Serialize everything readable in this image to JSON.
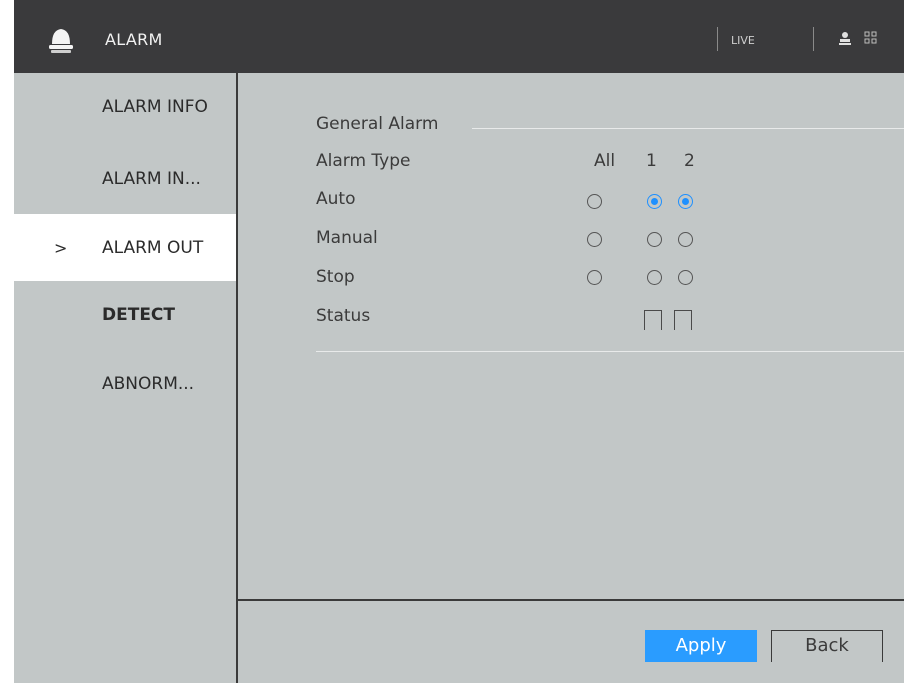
{
  "header": {
    "title": "ALARM",
    "live_label": "LIVE",
    "icons": [
      "alarm-bell-icon",
      "user-icon",
      "grid-icon"
    ]
  },
  "sidebar": {
    "items": [
      {
        "label": "ALARM INFO",
        "active": false,
        "bold": false
      },
      {
        "label": "ALARM IN...",
        "active": false,
        "bold": false
      },
      {
        "label": "ALARM OUT",
        "active": true,
        "bold": false,
        "chevron": ">"
      },
      {
        "label": "DETECT",
        "active": false,
        "bold": true
      },
      {
        "label": "ABNORM...",
        "active": false,
        "bold": false
      }
    ]
  },
  "main": {
    "section_title": "General Alarm",
    "table": {
      "header_label": "Alarm Type",
      "columns": [
        "All",
        "1",
        "2"
      ],
      "rows": [
        {
          "label": "Auto",
          "selected": [
            false,
            true,
            true
          ]
        },
        {
          "label": "Manual",
          "selected": [
            false,
            false,
            false
          ]
        },
        {
          "label": "Stop",
          "selected": [
            false,
            false,
            false
          ]
        }
      ],
      "status_label": "Status",
      "status_checked": [
        false,
        false
      ]
    }
  },
  "footer": {
    "apply_label": "Apply",
    "back_label": "Back"
  },
  "colors": {
    "header_bg": "#3a3a3c",
    "panel_bg": "#c2c7c7",
    "accent": "#1e90ff",
    "active_nav_bg": "#ffffff"
  }
}
